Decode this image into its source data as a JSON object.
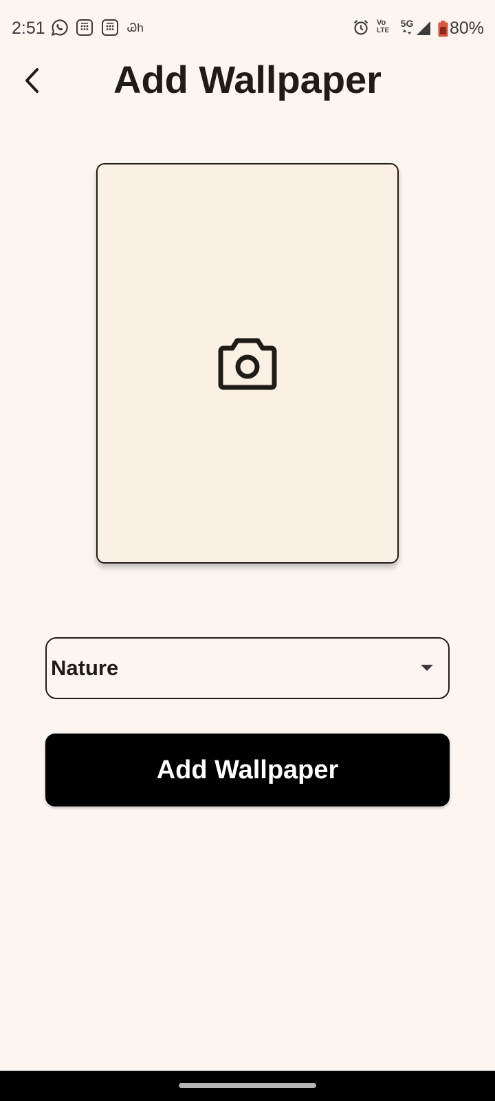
{
  "status_bar": {
    "time": "2:51",
    "network_type": "5G",
    "volte_label_top": "Vo",
    "volte_label_bottom": "LTE",
    "battery": "80%",
    "notification_text": "Ꮚh"
  },
  "header": {
    "title": "Add Wallpaper"
  },
  "image_picker": {
    "icon": "camera-icon"
  },
  "category": {
    "selected": "Nature"
  },
  "submit": {
    "label": "Add Wallpaper"
  },
  "colors": {
    "background": "#FDF6F0",
    "picker_fill": "#FBF0E4",
    "primary_text": "#1f1b16",
    "button": "#000000",
    "battery": "#E0533A"
  }
}
